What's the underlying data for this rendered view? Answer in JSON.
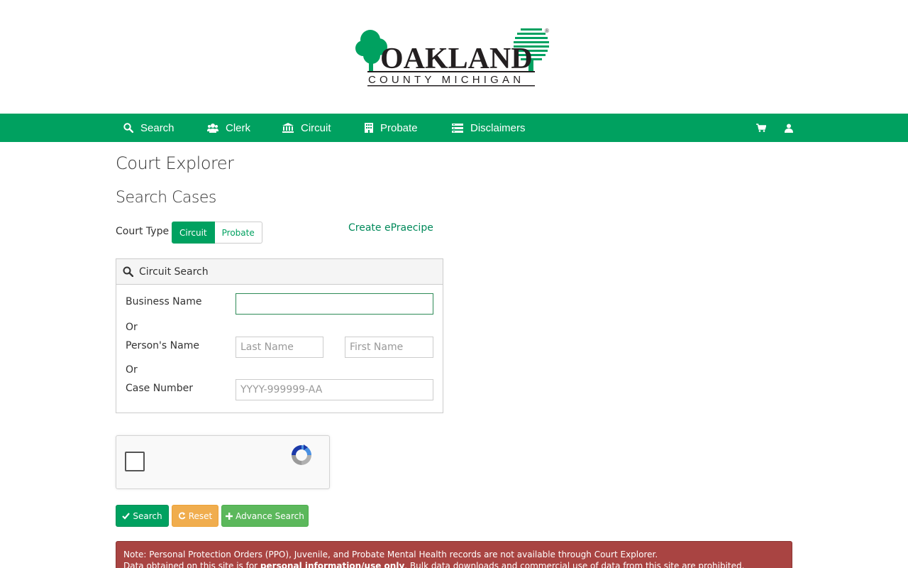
{
  "logo": {
    "name": "OAKLAND",
    "sub": "COUNTY MICHIGAN",
    "reg": "®"
  },
  "nav": {
    "search": "Search",
    "clerk": "Clerk",
    "circuit": "Circuit",
    "probate": "Probate",
    "disclaimers": "Disclaimers"
  },
  "page": {
    "title": "Court Explorer",
    "section": "Search Cases"
  },
  "court_type": {
    "label": "Court Type",
    "options": [
      "Circuit",
      "Probate"
    ],
    "selected": "Circuit"
  },
  "links": {
    "epraecipe": "Create ePraecipe"
  },
  "panel": {
    "title": "Circuit Search",
    "business_label": "Business Name",
    "business_value": "",
    "or1": "Or",
    "person_label": "Person's Name",
    "last_placeholder": "Last Name",
    "first_placeholder": "First Name",
    "or2": "Or",
    "case_label": "Case Number",
    "case_placeholder": "YYYY-999999-AA"
  },
  "buttons": {
    "search": "Search",
    "reset": "Reset",
    "advance": "Advance Search"
  },
  "alert": {
    "line1": "Note: Personal Protection Orders (PPO), Juvenile, and Probate Mental Health records are not available through Court Explorer.",
    "line2_pre": "Data obtained on this site is for ",
    "line2_bold": "personal information/use only",
    "line2_post": ". Bulk data downloads and commercial use of data from this site are prohibited."
  },
  "colors": {
    "brand_green": "#00a160",
    "reset_orange": "#f0ad4e",
    "advance_green": "#5cb85c",
    "alert_red": "#a94442"
  }
}
